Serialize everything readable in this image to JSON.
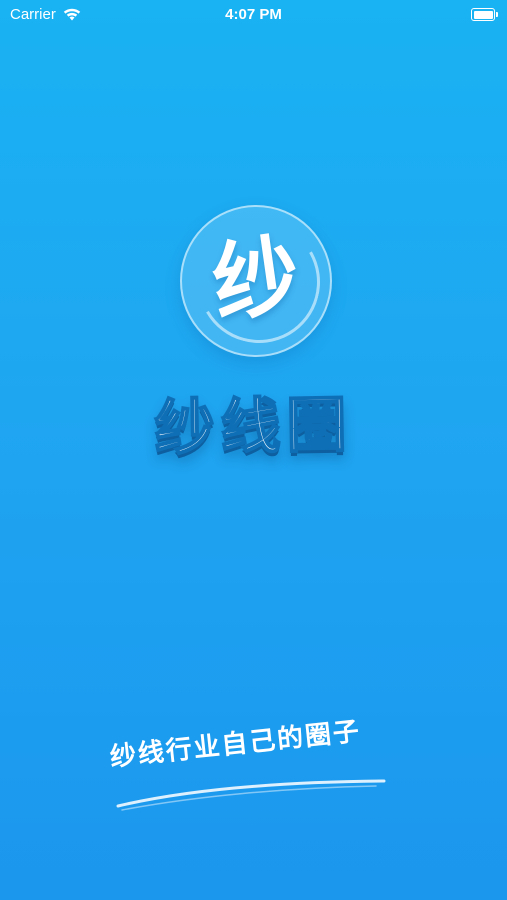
{
  "status_bar": {
    "carrier": "Carrier",
    "time": "4:07 PM"
  },
  "logo": {
    "char": "纱"
  },
  "app": {
    "name": "纱线圈",
    "slogan": "纱线行业自己的圈子"
  },
  "colors": {
    "background_top": "#19b2f2",
    "background_bottom": "#1b97ee",
    "text": "#ffffff",
    "stroke": "#0f6fb6"
  },
  "icons": {
    "wifi": "wifi-icon",
    "battery": "battery-icon"
  }
}
